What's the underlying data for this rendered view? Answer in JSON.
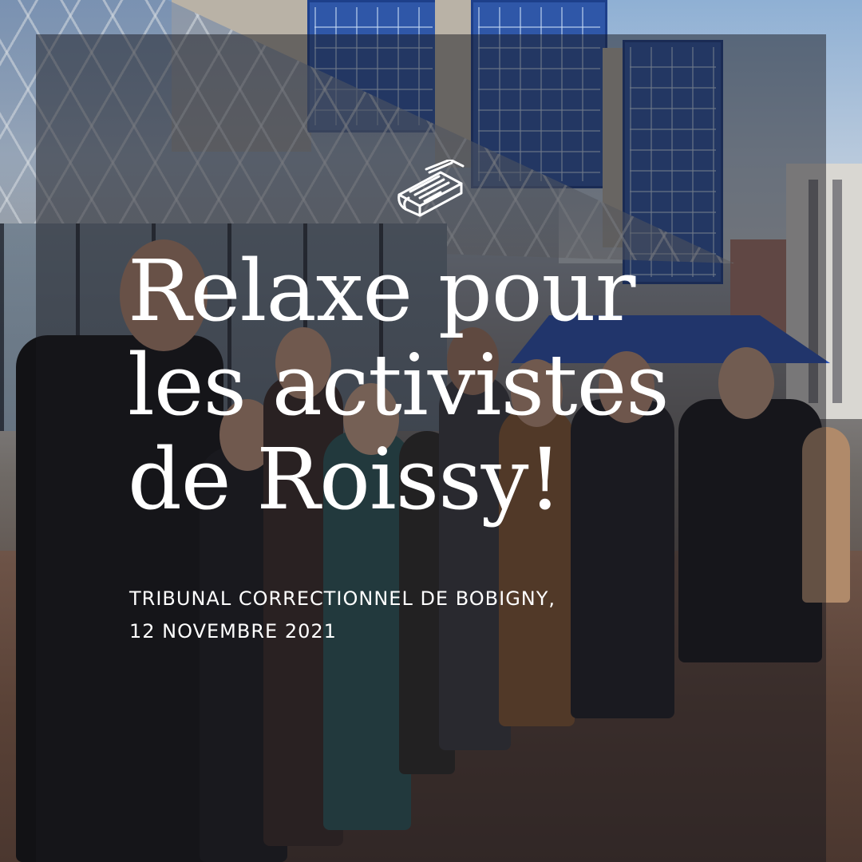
{
  "post": {
    "headline": {
      "line1": "Relaxe pour",
      "line2": "les activistes",
      "line3": "de Roissy!"
    },
    "subtitle": {
      "line1": "TRIBUNAL CORRECTIONNEL DE BOBIGNY,",
      "line2": "12 NOVEMBRE 2021"
    },
    "icon": "newspaper-icon",
    "colors": {
      "text": "#ffffff",
      "overlay": "#18181e",
      "building_blue": "#2f57a8"
    }
  }
}
